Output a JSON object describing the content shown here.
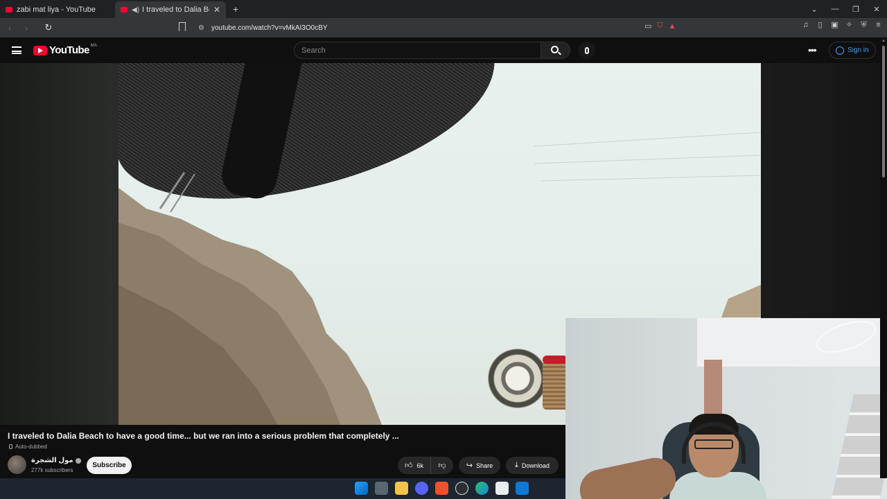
{
  "browser": {
    "tabs": [
      {
        "title": "zabi mat liya - YouTube",
        "active": false
      },
      {
        "title": "I traveled to Dalia Beach to h",
        "active": true
      }
    ],
    "url": "youtube.com/watch?v=vMkAI3O0cBY"
  },
  "youtube": {
    "logo_text": "YouTube",
    "country_code": "MA",
    "search_placeholder": "Search",
    "sign_in": "Sign in"
  },
  "video": {
    "title": "I traveled to Dalia Beach to have a good time... but we ran into a serious problem that completely ...",
    "auto_dubbed": "Auto-dubbed",
    "channel": "مول الشجرة",
    "subscribers": "277k subscribers",
    "subscribe_label": "Subscribe",
    "likes": "6k",
    "share_label": "Share",
    "download_label": "Download"
  },
  "colors": {
    "brand_red": "#ff0033",
    "link_blue": "#3ea6ff",
    "background": "#0f0f0f"
  },
  "taskbar_icons": [
    "windows-start-icon",
    "task-view-icon",
    "file-explorer-icon",
    "discord-icon",
    "brave-icon",
    "chatgpt-icon",
    "edge-icon",
    "store-icon",
    "mail-icon"
  ]
}
